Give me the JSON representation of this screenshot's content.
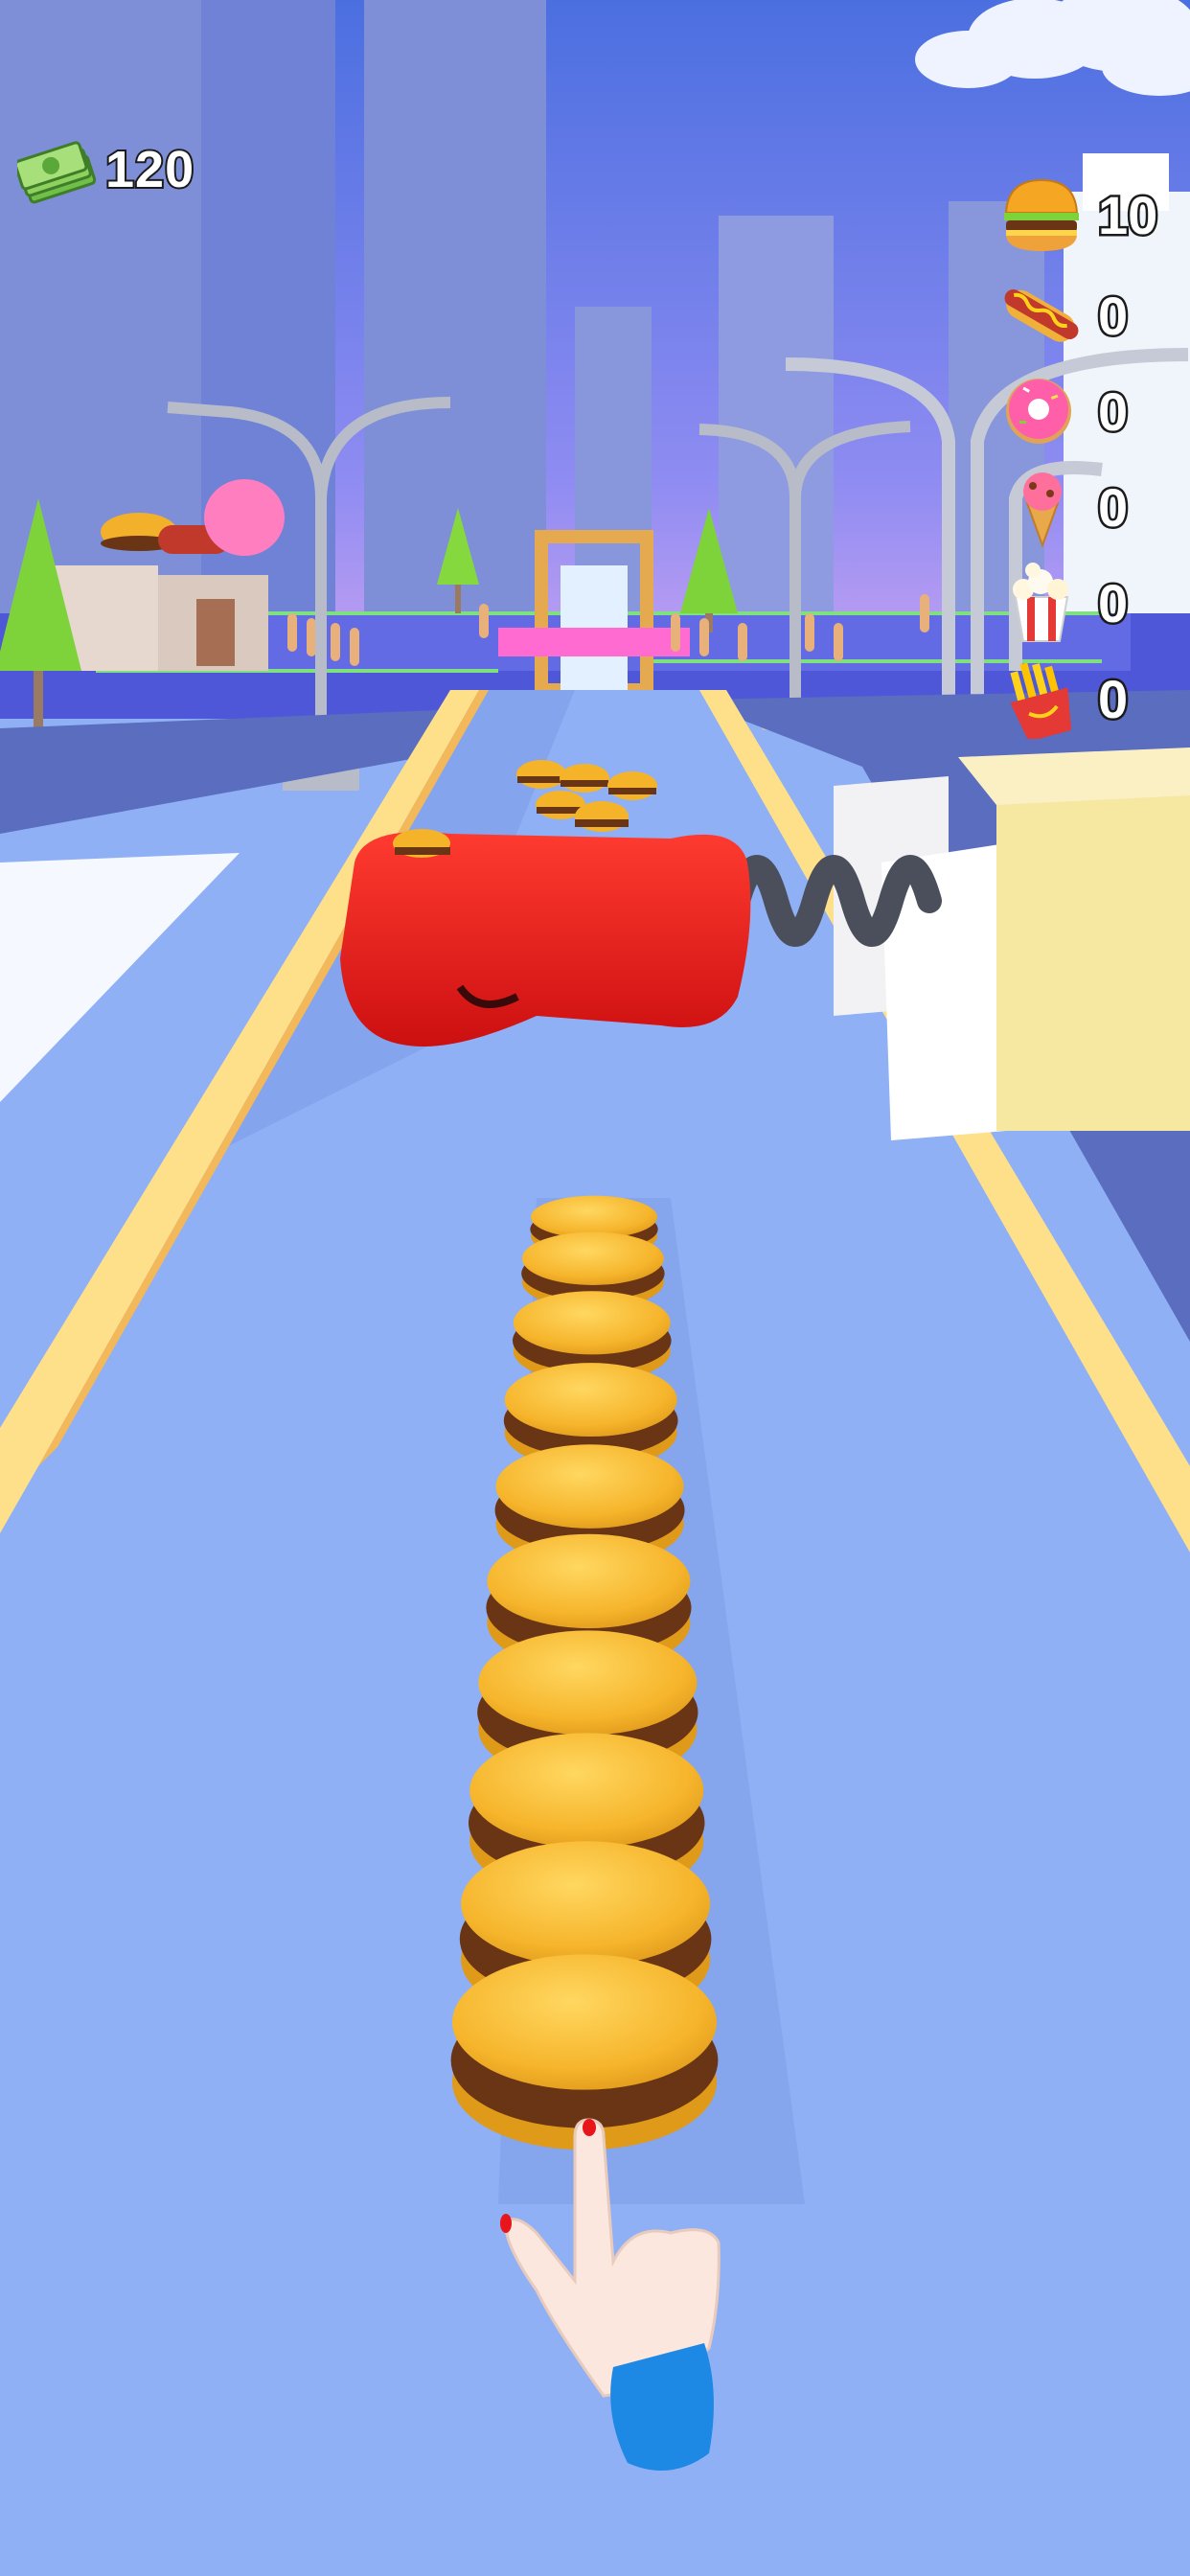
{
  "hud": {
    "cash": {
      "icon": "cash-stack-icon",
      "amount": "120"
    },
    "food_counters": [
      {
        "icon": "burger-icon",
        "count": "10"
      },
      {
        "icon": "hotdog-icon",
        "count": "0"
      },
      {
        "icon": "donut-icon",
        "count": "0"
      },
      {
        "icon": "ice-cream-icon",
        "count": "0"
      },
      {
        "icon": "popcorn-icon",
        "count": "0"
      },
      {
        "icon": "fries-icon",
        "count": "0"
      }
    ]
  },
  "game": {
    "burger_stack_count": 10,
    "obstacle": "boxing-glove-punch",
    "colors": {
      "sky": "#5f7ee6",
      "track": "#8fb0f4",
      "rail": "#ffe08a",
      "glove": "#e8151b",
      "bun": "#f5b32a",
      "patty": "#6a3515",
      "sleeve": "#1e88e5"
    }
  }
}
